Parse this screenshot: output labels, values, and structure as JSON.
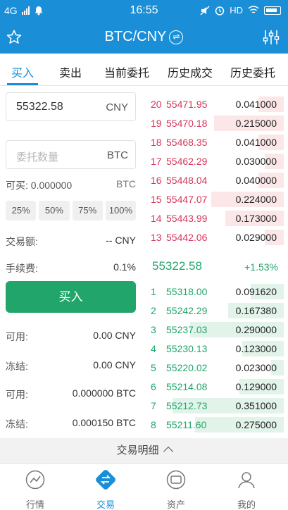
{
  "status_bar": {
    "network": "4G",
    "time": "16:55",
    "hd": "HD"
  },
  "header": {
    "title": "BTC/CNY",
    "swap_glyph": "⇌"
  },
  "tabs": [
    "买入",
    "卖出",
    "当前委托",
    "历史成交",
    "历史委托"
  ],
  "order_form": {
    "price_value": "55322.58",
    "price_unit": "CNY",
    "amount_placeholder": "委托数量",
    "amount_unit": "BTC",
    "can_buy_label": "可买: 0.000000",
    "can_buy_unit": "BTC",
    "percent_buttons": [
      "25%",
      "50%",
      "75%",
      "100%"
    ],
    "trade_amount_label": "交易额:",
    "trade_amount_value": "-- CNY",
    "fee_label": "手续费:",
    "fee_value": "0.1%",
    "buy_button": "买入",
    "balances": [
      {
        "label": "可用:",
        "value": "0.00 CNY"
      },
      {
        "label": "冻结:",
        "value": "0.00 CNY"
      },
      {
        "label": "可用:",
        "value": "0.000000 BTC"
      },
      {
        "label": "冻结:",
        "value": "0.000150 BTC"
      }
    ]
  },
  "order_book": {
    "asks": [
      {
        "idx": "20",
        "price": "55471.95",
        "amount": "0.041000",
        "depth": 0.2
      },
      {
        "idx": "19",
        "price": "55470.18",
        "amount": "0.215000",
        "depth": 0.55
      },
      {
        "idx": "18",
        "price": "55468.35",
        "amount": "0.041000",
        "depth": 0.2
      },
      {
        "idx": "17",
        "price": "55462.29",
        "amount": "0.030000",
        "depth": 0.15
      },
      {
        "idx": "16",
        "price": "55448.04",
        "amount": "0.040000",
        "depth": 0.2
      },
      {
        "idx": "15",
        "price": "55447.07",
        "amount": "0.224000",
        "depth": 0.57
      },
      {
        "idx": "14",
        "price": "55443.99",
        "amount": "0.173000",
        "depth": 0.46
      },
      {
        "idx": "13",
        "price": "55442.06",
        "amount": "0.029000",
        "depth": 0.15
      }
    ],
    "last_price": "55322.58",
    "change": "+1.53%",
    "bids": [
      {
        "idx": "1",
        "price": "55318.00",
        "amount": "0.091620",
        "depth": 0.26
      },
      {
        "idx": "2",
        "price": "55242.29",
        "amount": "0.167380",
        "depth": 0.44
      },
      {
        "idx": "3",
        "price": "55237.03",
        "amount": "0.290000",
        "depth": 0.74
      },
      {
        "idx": "4",
        "price": "55230.13",
        "amount": "0.123000",
        "depth": 0.33
      },
      {
        "idx": "5",
        "price": "55220.02",
        "amount": "0.023000",
        "depth": 0.1
      },
      {
        "idx": "6",
        "price": "55214.08",
        "amount": "0.129000",
        "depth": 0.35
      },
      {
        "idx": "7",
        "price": "55212.73",
        "amount": "0.351000",
        "depth": 0.88
      },
      {
        "idx": "8",
        "price": "55211.60",
        "amount": "0.275000",
        "depth": 0.7
      }
    ]
  },
  "detail_bar": {
    "label": "交易明细"
  },
  "bottom_nav": [
    {
      "label": "行情",
      "icon": "chart-icon"
    },
    {
      "label": "交易",
      "icon": "trade-icon"
    },
    {
      "label": "资产",
      "icon": "wallet-icon"
    },
    {
      "label": "我的",
      "icon": "user-icon"
    }
  ],
  "colors": {
    "primary": "#1a8fd8",
    "buy": "#21a56a",
    "sell": "#d6345a"
  }
}
